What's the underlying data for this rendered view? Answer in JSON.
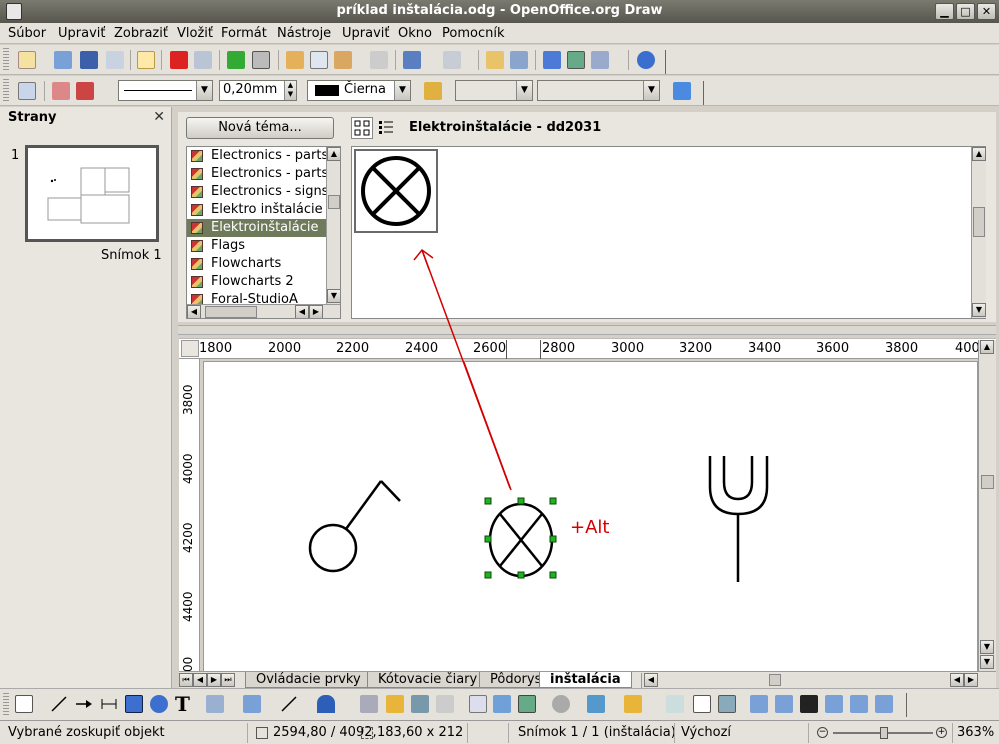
{
  "window": {
    "title": "príklad inštalácia.odg - OpenOffice.org Draw",
    "min_glyph": "▁",
    "max_glyph": "□",
    "close_glyph": "✕"
  },
  "menu": [
    "Súbor",
    "Upraviť",
    "Zobraziť",
    "Vložiť",
    "Formát",
    "Nástroje",
    "Upraviť",
    "Okno",
    "Pomocník"
  ],
  "toolbar2": {
    "line_width": "0,20mm",
    "color_name": "Čierna"
  },
  "pages_panel": {
    "title": "Strany",
    "page_number": "1",
    "slide_label": "Snímok 1"
  },
  "gallery": {
    "new_theme_label": "Nová téma...",
    "themes": [
      "Electronics - parts",
      "Electronics - parts",
      "Electronics - signs",
      "Elektro inštalácie",
      "Elektroinštalácie",
      "Flags",
      "Flowcharts",
      "Flowcharts 2",
      "Foral-StudioA"
    ],
    "selected_index": 4,
    "current_theme_title": "Elektroinštalácie - dd2031"
  },
  "ruler": {
    "h_labels": [
      "1800",
      "2000",
      "2200",
      "2400",
      "2600",
      "2800",
      "3000",
      "3200",
      "3400",
      "3600",
      "3800",
      "400"
    ],
    "v_labels": [
      "3800",
      "4000",
      "4200",
      "4400",
      "00"
    ]
  },
  "canvas": {
    "annotation": "+Alt",
    "annotation_color": "#d40000",
    "arrow_color": "#d40000"
  },
  "sheet_tabs": [
    "Ovládacie prvky",
    "Kótovacie čiary",
    "Pôdorys",
    "inštalácia"
  ],
  "active_tab_index": 3,
  "status": {
    "message": "Vybrané zoskupiť objekt",
    "position": "2594,80 / 4092,",
    "size": "183,60 x 212",
    "slide": "Snímok 1 / 1 (inštalácia)",
    "layout": "Výchozí",
    "zoom": "363%"
  }
}
